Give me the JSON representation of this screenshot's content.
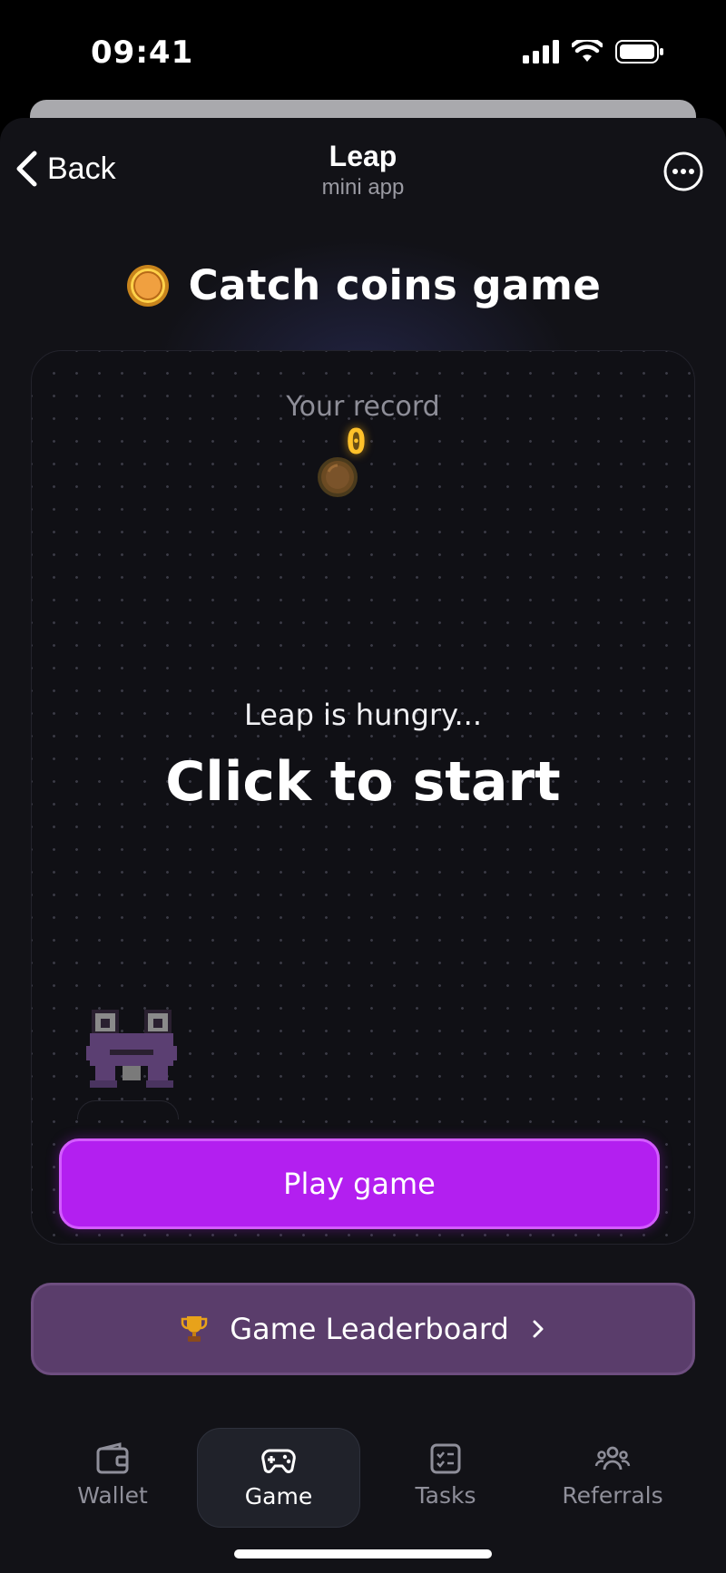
{
  "status_bar": {
    "time": "09:41"
  },
  "nav": {
    "back_label": "Back",
    "title": "Leap",
    "subtitle": "mini app"
  },
  "game": {
    "title": "Catch coins game",
    "record_label": "Your record",
    "record_value": "0",
    "hungry_text": "Leap is hungry...",
    "start_text": "Click to start",
    "play_label": "Play game"
  },
  "leaderboard": {
    "label": "Game Leaderboard"
  },
  "tabs": [
    {
      "label": "Wallet",
      "icon": "wallet-icon"
    },
    {
      "label": "Game",
      "icon": "gamepad-icon",
      "active": true
    },
    {
      "label": "Tasks",
      "icon": "tasks-icon"
    },
    {
      "label": "Referrals",
      "icon": "referrals-icon"
    }
  ],
  "colors": {
    "accent": "#b31ff0",
    "leaderboard": "#5a3d6b",
    "coin": "#f0a040",
    "record": "#ffc12a",
    "frog": "#5b3f72"
  }
}
